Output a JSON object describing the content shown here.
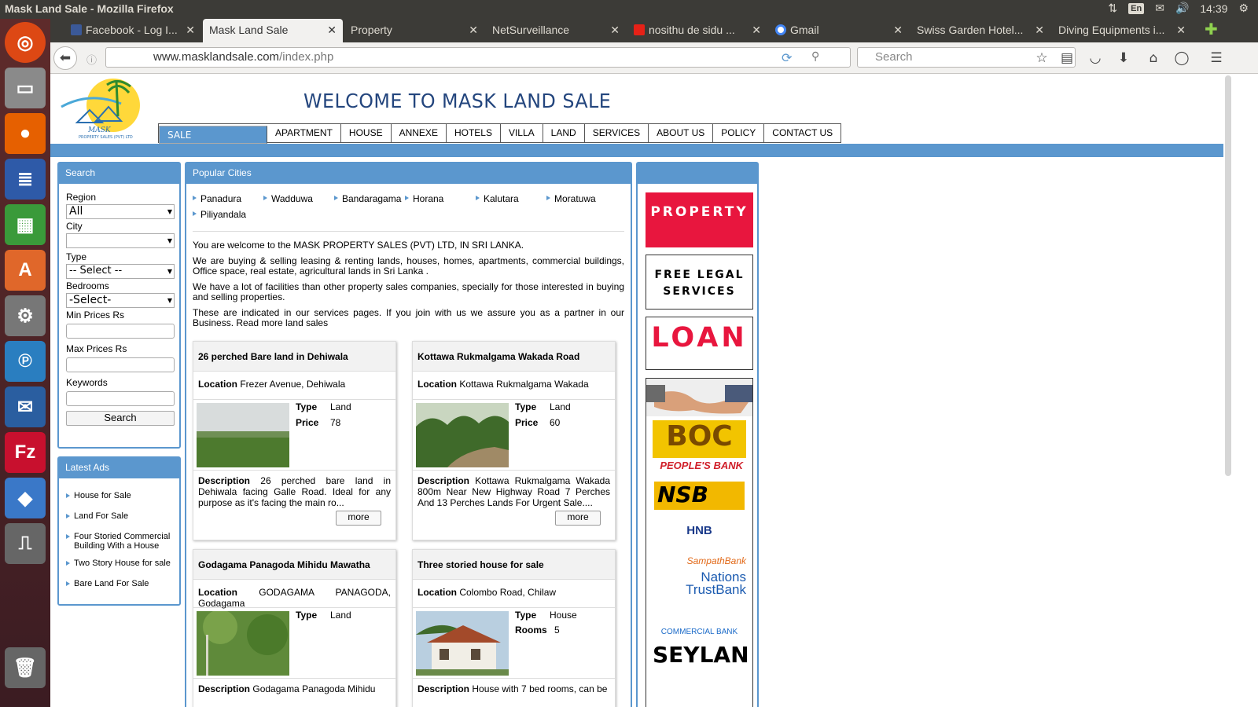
{
  "os": {
    "window_title": "Mask Land Sale - Mozilla Firefox",
    "lang": "En",
    "time": "14:39"
  },
  "browser": {
    "tabs": [
      {
        "label": "Facebook - Log I..."
      },
      {
        "label": "Mask Land Sale"
      },
      {
        "label": "Property"
      },
      {
        "label": "NetSurveillance"
      },
      {
        "label": "nosithu de sidu ..."
      },
      {
        "label": "Gmail"
      },
      {
        "label": "Swiss Garden Hotel..."
      },
      {
        "label": "Diving Equipments i..."
      }
    ],
    "url_domain": "www.masklandsale.com",
    "url_path": "/index.php",
    "search_placeholder": "Search"
  },
  "site": {
    "welcome": "WELCOME TO MASK LAND SALE",
    "logo_text": "MASK",
    "logo_sub": "PROPERTY SALES (PVT) LTD",
    "menu": [
      "SALE",
      "APARTMENT",
      "HOUSE",
      "ANNEXE",
      "HOTELS",
      "VILLA",
      "LAND",
      "SERVICES",
      "ABOUT US",
      "POLICY",
      "CONTACT US"
    ]
  },
  "search": {
    "title": "Search",
    "region_label": "Region",
    "region_value": "All",
    "city_label": "City",
    "city_value": "",
    "type_label": "Type",
    "type_value": "-- Select --",
    "bedrooms_label": "Bedrooms",
    "bedrooms_value": "-Select-",
    "min_label": "Min Prices Rs",
    "max_label": "Max Prices Rs",
    "keywords_label": "Keywords",
    "button": "Search"
  },
  "latest": {
    "title": "Latest Ads",
    "items": [
      "House for Sale",
      "Land For Sale",
      "Four Storied Commercial Building With a House",
      "Two Story House for sale",
      "Bare Land For Sale"
    ]
  },
  "popular": {
    "title": "Popular Cities",
    "cities": [
      "Panadura",
      "Wadduwa",
      "Bandaragama",
      "Horana",
      "Kalutara",
      "Moratuwa",
      "Piliyandala"
    ],
    "intro": [
      "You are welcome to the MASK PROPERTY SALES (PVT) LTD, IN SRI LANKA.",
      "We are buying & selling leasing & renting lands, houses, homes, apartments, commercial buildings, Office space, real estate, agricultural lands in Sri Lanka .",
      "We have a lot of facilities than other property sales companies, specially for those interested in buying and selling properties.",
      "These are indicated in our services pages. If you join with us we assure you as a partner in our Business. Read more land sales"
    ]
  },
  "labels": {
    "location": "Location",
    "type": "Type",
    "price": "Price",
    "rooms": "Rooms",
    "description": "Description",
    "more": "more"
  },
  "listings": [
    {
      "title": "26 perched Bare land in Dehiwala",
      "location": "Frezer Avenue, Dehiwala",
      "type": "Land",
      "price": "78",
      "description": "26 perched bare land in Dehiwala facing Galle Road. Ideal for any purpose as it's facing the main ro..."
    },
    {
      "title": "Kottawa Rukmalgama Wakada Road",
      "location": "Kottawa Rukmalgama Wakada",
      "type": "Land",
      "price": "60",
      "description": "Kottawa Rukmalgama Wakada 800m Near New Highway Road 7 Perches And 13 Perches Lands For Urgent Sale...."
    },
    {
      "title": "Godagama Panagoda Mihidu Mawatha",
      "location": "GODAGAMA PANAGODA, Godagama",
      "type": "Land",
      "description": "Godagama Panagoda Mihidu"
    },
    {
      "title": "Three storied house for sale",
      "location": "Colombo Road, Chilaw",
      "type": "House",
      "rooms": "5",
      "description": "House with 7 bed rooms, can be"
    }
  ],
  "ads": {
    "property": "PROPERTY",
    "legal_1": "FREE LEGAL",
    "legal_2": "SERVICES",
    "loan": "LOAN",
    "banks": [
      "BOC",
      "PEOPLE'S BANK",
      "NSB",
      "HNB",
      "SampathBank",
      "Nations TrustBank",
      "COMMERCIAL BANK",
      "SEYLAN"
    ]
  },
  "colors": {
    "accent": "#5b97ce",
    "brand_text": "#23457d",
    "ad_red": "#e8163e"
  }
}
